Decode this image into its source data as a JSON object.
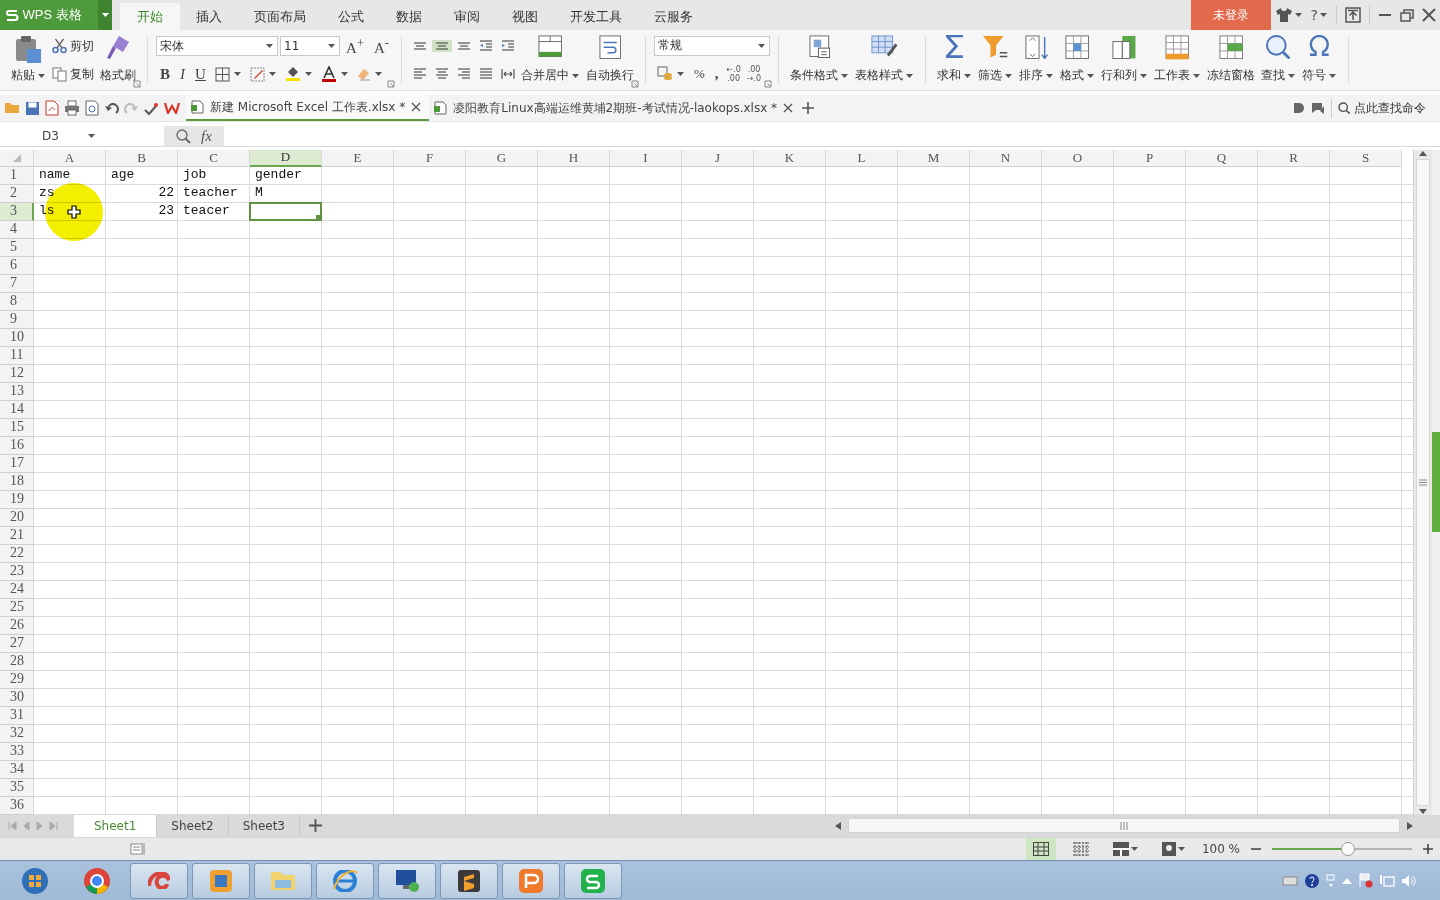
{
  "app_button": {
    "label": "WPS 表格"
  },
  "ribbon_tabs": [
    {
      "label": "开始",
      "selected": true
    },
    {
      "label": "插入",
      "selected": false
    },
    {
      "label": "页面布局",
      "selected": false
    },
    {
      "label": "公式",
      "selected": false
    },
    {
      "label": "数据",
      "selected": false
    },
    {
      "label": "审阅",
      "selected": false
    },
    {
      "label": "视图",
      "selected": false
    },
    {
      "label": "开发工具",
      "selected": false
    },
    {
      "label": "云服务",
      "selected": false
    }
  ],
  "login_button": "未登录",
  "help_button": "?",
  "clipboard": {
    "paste": "粘贴",
    "cut": "剪切",
    "copy": "复制",
    "format_painter": "格式刷"
  },
  "font": {
    "name": "宋体",
    "size": "11",
    "grow": "A$^{+}$",
    "shrink": "A$^{-}$",
    "bold": "B",
    "italic": "I",
    "underline": "U"
  },
  "align_buttons": [
    {
      "label": "合并居中",
      "menu": true
    },
    {
      "label": "自动换行",
      "menu": false
    }
  ],
  "number_format": {
    "value": "常规",
    "percent": "%",
    "thousands": ",",
    "increase_decimal": [
      "←.0",
      ".00"
    ],
    "decrease_decimal": [
      ".00",
      "→.0"
    ]
  },
  "style_buttons": [
    {
      "label": "条件格式",
      "menu": true
    },
    {
      "label": "表格样式",
      "menu": true
    }
  ],
  "edit_buttons": [
    {
      "label": "求和",
      "menu": true
    },
    {
      "label": "筛选",
      "menu": true
    },
    {
      "label": "排序",
      "menu": true
    },
    {
      "label": "格式",
      "menu": true
    },
    {
      "label": "行和列",
      "menu": true
    },
    {
      "label": "工作表",
      "menu": true
    },
    {
      "label": "冻结窗格",
      "menu": false
    },
    {
      "label": "查找",
      "menu": true
    },
    {
      "label": "符号",
      "menu": true
    }
  ],
  "doc_tabs": [
    {
      "title": "新建 Microsoft Excel 工作表.xlsx *",
      "selected": true
    },
    {
      "title": "凌阳教育Linux高端运维黄埔2期班-考试情况-laokops.xlsx *",
      "selected": false
    }
  ],
  "command_search": {
    "placeholder": "点此查找命令"
  },
  "name_box": "D3",
  "fx": "fx",
  "columns": [
    {
      "label": "A",
      "selected": false
    },
    {
      "label": "B",
      "selected": false
    },
    {
      "label": "C",
      "selected": false
    },
    {
      "label": "D",
      "selected": true
    },
    {
      "label": "E",
      "selected": false
    },
    {
      "label": "F",
      "selected": false
    },
    {
      "label": "G",
      "selected": false
    },
    {
      "label": "H",
      "selected": false
    },
    {
      "label": "I",
      "selected": false
    },
    {
      "label": "J",
      "selected": false
    },
    {
      "label": "K",
      "selected": false
    },
    {
      "label": "L",
      "selected": false
    },
    {
      "label": "M",
      "selected": false
    },
    {
      "label": "N",
      "selected": false
    },
    {
      "label": "O",
      "selected": false
    },
    {
      "label": "P",
      "selected": false
    },
    {
      "label": "Q",
      "selected": false
    },
    {
      "label": "R",
      "selected": false
    },
    {
      "label": "S",
      "selected": false
    }
  ],
  "rows": [
    {
      "label": "1",
      "selected": false,
      "cells": [
        {
          "value": "name",
          "numeric": false,
          "selected": false
        },
        {
          "value": "age",
          "numeric": false,
          "selected": false
        },
        {
          "value": "job",
          "numeric": false,
          "selected": false
        },
        {
          "value": "gender",
          "numeric": false,
          "selected": false
        }
      ]
    },
    {
      "label": "2",
      "selected": false,
      "cells": [
        {
          "value": "zs",
          "numeric": false,
          "selected": false
        },
        {
          "value": "22",
          "numeric": true,
          "selected": false
        },
        {
          "value": "teacher",
          "numeric": false,
          "selected": false
        },
        {
          "value": "M",
          "numeric": false,
          "selected": false
        }
      ]
    },
    {
      "label": "3",
      "selected": true,
      "cells": [
        {
          "value": "ls",
          "numeric": false,
          "selected": false
        },
        {
          "value": "23",
          "numeric": true,
          "selected": false
        },
        {
          "value": "teacer",
          "numeric": false,
          "selected": false
        },
        {
          "selected": true
        }
      ]
    },
    {
      "label": "4",
      "selected": false
    },
    {
      "label": "5",
      "selected": false
    },
    {
      "label": "6",
      "selected": false
    },
    {
      "label": "7",
      "selected": false
    },
    {
      "label": "8",
      "selected": false
    },
    {
      "label": "9",
      "selected": false
    },
    {
      "label": "10",
      "selected": false
    },
    {
      "label": "11",
      "selected": false
    },
    {
      "label": "12",
      "selected": false
    },
    {
      "label": "13",
      "selected": false
    },
    {
      "label": "14",
      "selected": false
    },
    {
      "label": "15",
      "selected": false
    },
    {
      "label": "16",
      "selected": false
    },
    {
      "label": "17",
      "selected": false
    },
    {
      "label": "18",
      "selected": false
    },
    {
      "label": "19",
      "selected": false
    },
    {
      "label": "20",
      "selected": false
    },
    {
      "label": "21",
      "selected": false
    },
    {
      "label": "22",
      "selected": false
    },
    {
      "label": "23",
      "selected": false
    },
    {
      "label": "24",
      "selected": false
    },
    {
      "label": "25",
      "selected": false
    },
    {
      "label": "26",
      "selected": false
    },
    {
      "label": "27",
      "selected": false
    },
    {
      "label": "28",
      "selected": false
    },
    {
      "label": "29",
      "selected": false
    },
    {
      "label": "30",
      "selected": false
    },
    {
      "label": "31",
      "selected": false
    },
    {
      "label": "32",
      "selected": false
    },
    {
      "label": "33",
      "selected": false
    },
    {
      "label": "34",
      "selected": false
    },
    {
      "label": "35",
      "selected": false
    },
    {
      "label": "36",
      "selected": false
    }
  ],
  "sheet_tabs": [
    {
      "label": "Sheet1",
      "selected": true
    },
    {
      "label": "Sheet2",
      "selected": false
    },
    {
      "label": "Sheet3",
      "selected": false
    }
  ],
  "zoom": {
    "reading": "100 %",
    "level": 0.49
  },
  "taskbar": [
    {
      "open": false
    },
    {
      "open": false
    },
    {
      "open": true
    },
    {
      "open": true
    },
    {
      "open": true
    },
    {
      "open": true
    },
    {
      "open": true
    },
    {
      "open": true
    },
    {
      "open": true
    },
    {
      "open": true
    }
  ]
}
